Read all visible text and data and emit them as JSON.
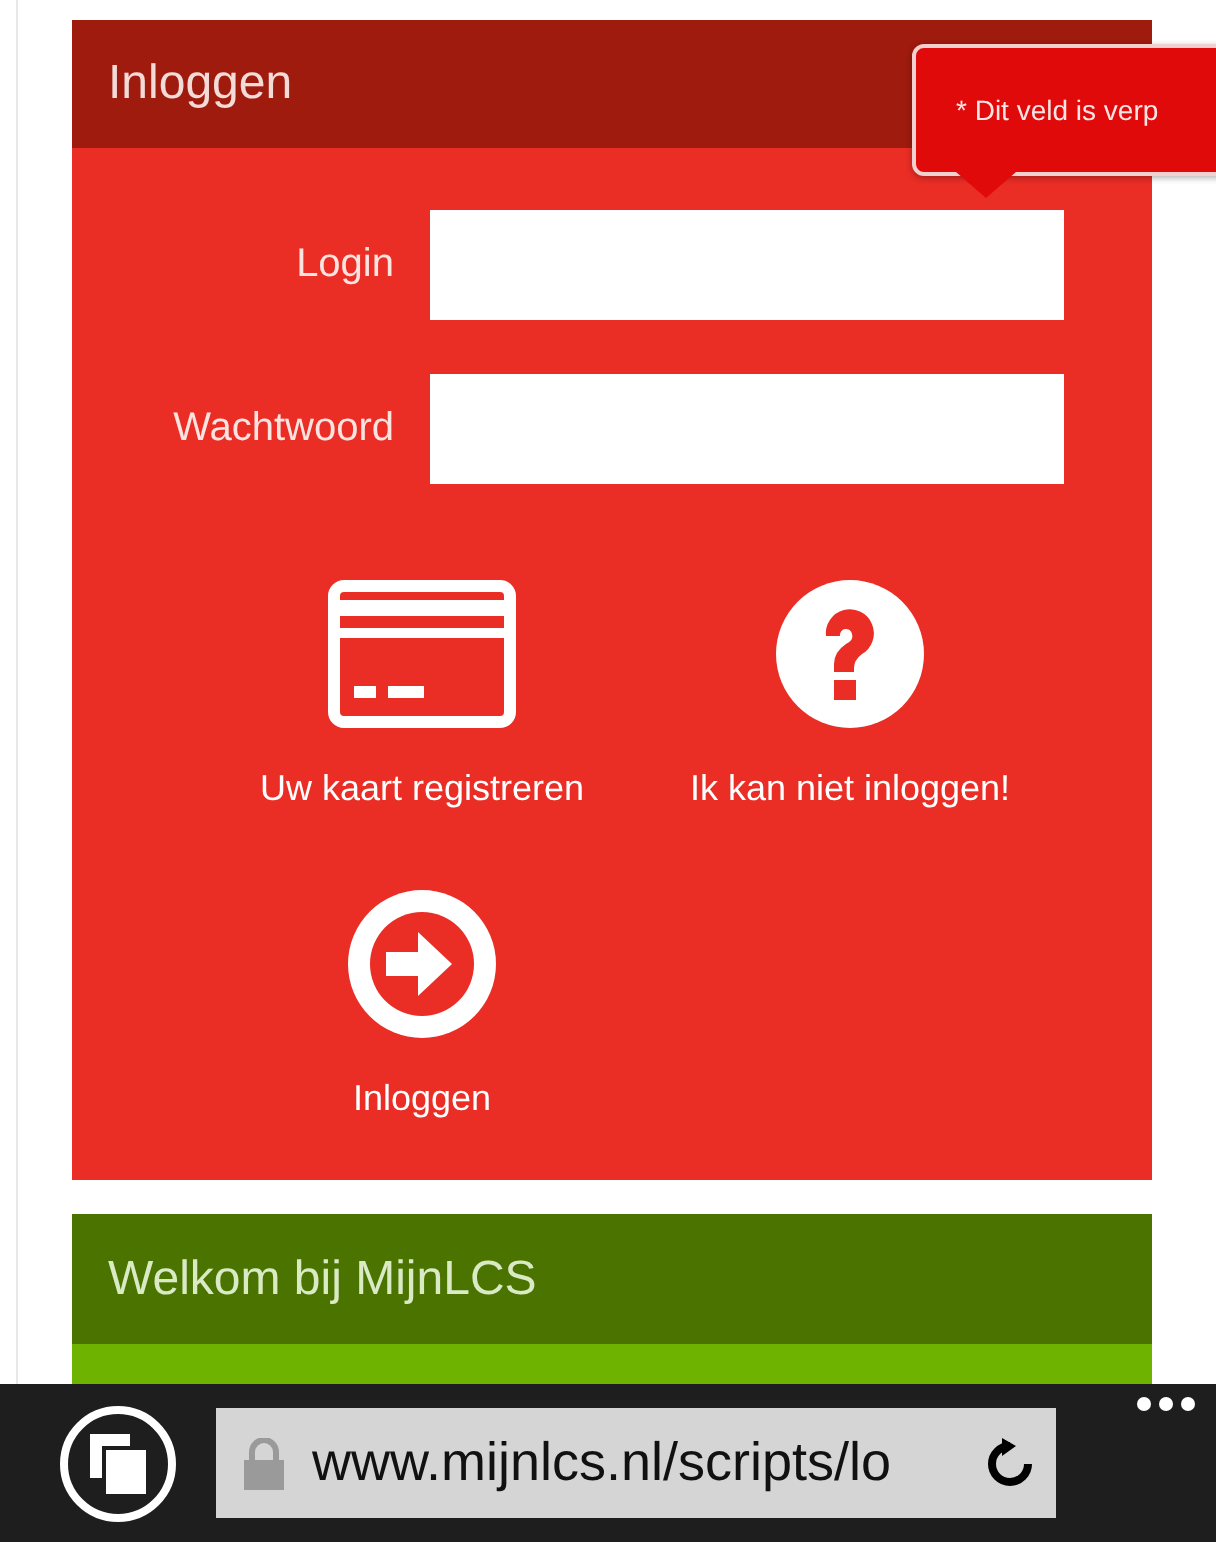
{
  "login_panel": {
    "title": "Inloggen",
    "fields": [
      {
        "label": "Login"
      },
      {
        "label": "Wachtwoord"
      }
    ],
    "tooltip": "* Dit veld is verp",
    "tiles": [
      {
        "kind": "card",
        "label": "Uw kaart registreren"
      },
      {
        "kind": "help",
        "label": "Ik kan niet inloggen!"
      },
      {
        "kind": "submit",
        "label": "Inloggen"
      }
    ]
  },
  "welcome_panel": {
    "title": "Welkom bij MijnLCS"
  },
  "browser_bar": {
    "url": "www.mijnlcs.nl/scripts/lo"
  }
}
